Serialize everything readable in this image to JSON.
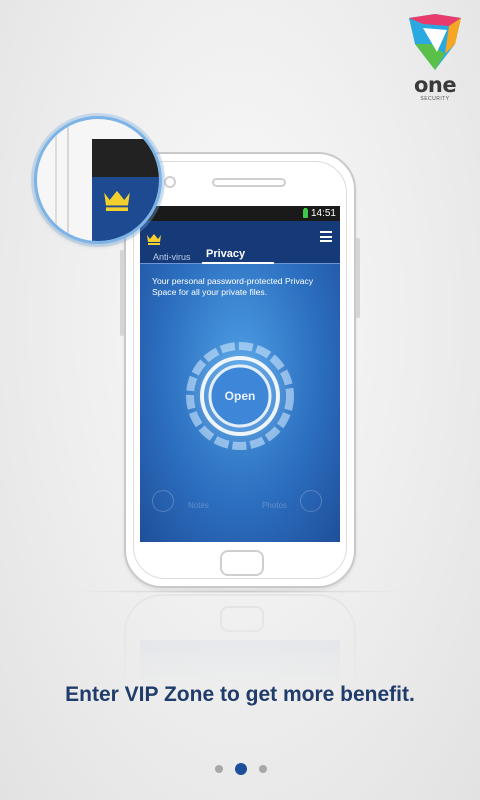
{
  "logo": {
    "wordmark": "one",
    "subtitle": "SECURITY",
    "colors": [
      "#e83b6b",
      "#f6a623",
      "#2aa9e0",
      "#5bc04a"
    ]
  },
  "device_screen": {
    "status_bar": {
      "time": "14:51",
      "battery_icon": "battery-charging-icon"
    },
    "app_bar": {
      "crown_icon": "crown-icon",
      "menu_icon": "menu-icon"
    },
    "tabs": [
      {
        "label": "Anti-virus",
        "active": false
      },
      {
        "label": "Privacy",
        "active": true
      }
    ],
    "description": "Your personal password-protected Privacy Space for all your private files.",
    "open_button": {
      "label": "Open"
    },
    "shortcuts": [
      {
        "label": "Notes",
        "icon": "notes-icon"
      },
      {
        "label": "Photos",
        "icon": "photos-icon"
      }
    ]
  },
  "tagline": "Enter VIP Zone to get more benefit.",
  "pagination": {
    "total": 3,
    "active_index": 1
  },
  "colors": {
    "accent": "#1e4f9a",
    "crown": "#f4d02e",
    "tagline": "#1f3c6b",
    "screen_blue": "#2c6fc0"
  }
}
